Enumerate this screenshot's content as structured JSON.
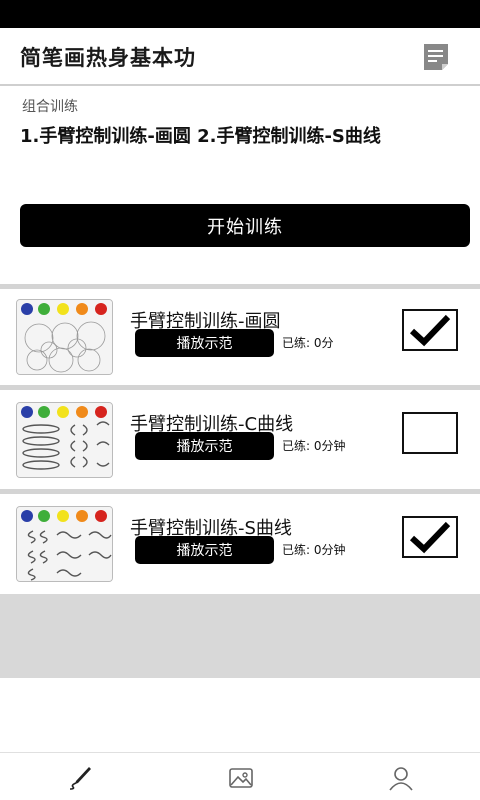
{
  "header": {
    "title": "简笔画热身基本功",
    "notes_icon": "notes-icon"
  },
  "combo": {
    "label": "组合训练",
    "description": "1.手臂控制训练-画圆 2.手臂控制训练-S曲线"
  },
  "start_button": {
    "label": "开始训练"
  },
  "exercises": [
    {
      "title": "手臂控制训练-画圆",
      "demo_label": "播放示范",
      "practiced": "已练: 0分",
      "checked": true,
      "thumb": "circles-sketch"
    },
    {
      "title": "手臂控制训练-C曲线",
      "demo_label": "播放示范",
      "practiced": "已练: 0分钟",
      "checked": false,
      "thumb": "c-curves-sketch"
    },
    {
      "title": "手臂控制训练-S曲线",
      "demo_label": "播放示范",
      "practiced": "已练: 0分钟",
      "checked": true,
      "thumb": "s-curves-sketch"
    }
  ],
  "bottom_nav": [
    {
      "name": "draw",
      "icon": "pen-icon"
    },
    {
      "name": "gallery",
      "icon": "image-icon"
    },
    {
      "name": "profile",
      "icon": "user-icon"
    }
  ],
  "colors": {
    "primary": "#000000",
    "divider": "#d4d4d4",
    "paint_dots": [
      "#2a3fa8",
      "#3fae3a",
      "#f2e21c",
      "#f08a1a",
      "#d6241e"
    ]
  }
}
